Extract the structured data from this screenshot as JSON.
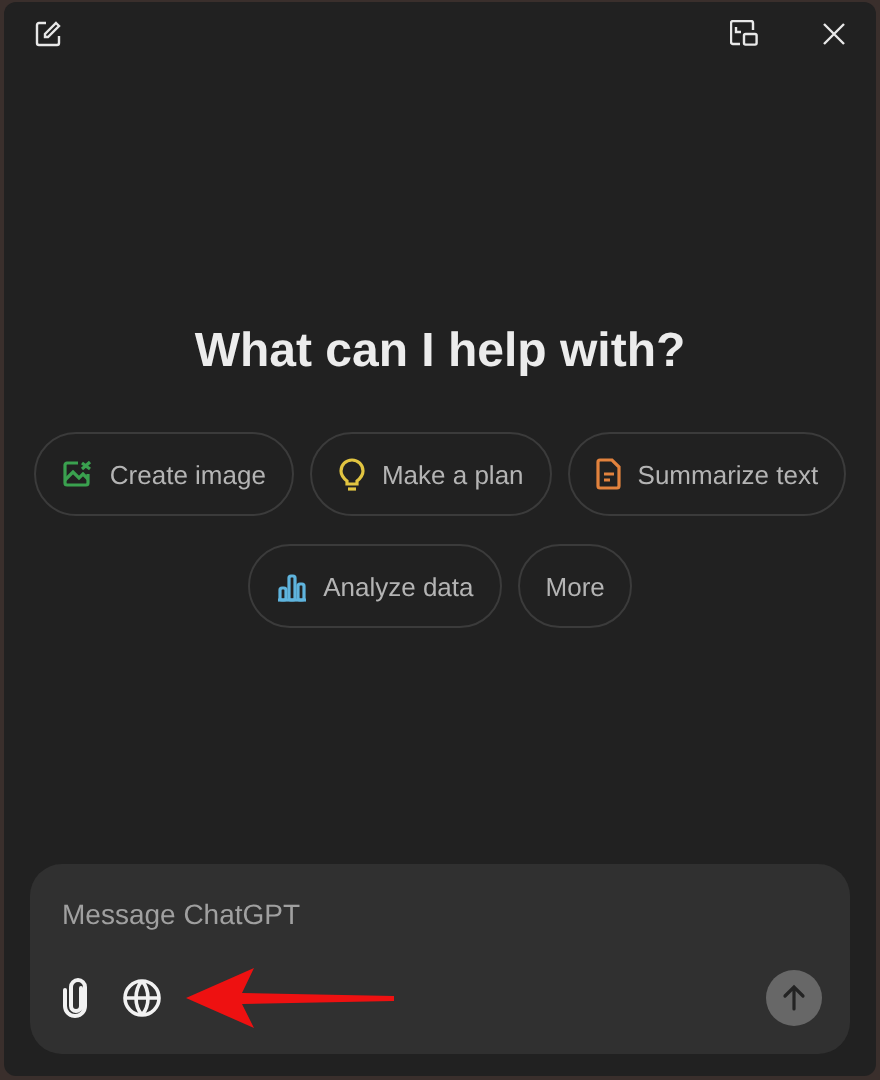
{
  "heading": "What can I help with?",
  "suggestions": [
    {
      "label": "Create image",
      "kind": "image",
      "color": "#3aa14f"
    },
    {
      "label": "Make a plan",
      "kind": "bulb",
      "color": "#e2c541"
    },
    {
      "label": "Summarize text",
      "kind": "document",
      "color": "#e2823d"
    },
    {
      "label": "Analyze data",
      "kind": "chart",
      "color": "#5fb4dd"
    },
    {
      "label": "More",
      "kind": "none"
    }
  ],
  "composer": {
    "placeholder": "Message ChatGPT",
    "send_disabled": true
  }
}
